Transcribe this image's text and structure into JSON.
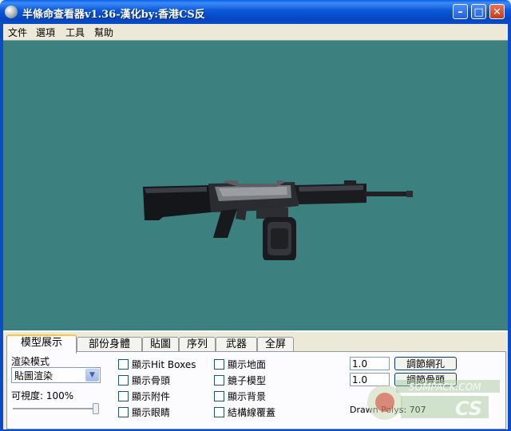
{
  "window": {
    "title": "半條命查看器v1.36-漢化by:香港CS反",
    "minimize_label": "–",
    "maximize_label": "□",
    "close_label": "✕"
  },
  "menu": [
    "文件",
    "選項",
    "工具",
    "幫助"
  ],
  "tabs": [
    "模型展示",
    "部份身體",
    "貼圖",
    "序列",
    "武器",
    "全屏"
  ],
  "render": {
    "section_label": "渲染模式",
    "mode_value": "貼圖渲染",
    "opacity_label": "可視度: 100%",
    "opacity_percent": 100
  },
  "checkboxes_col1": [
    "顯示Hit Boxes",
    "顯示骨頭",
    "顯示附件",
    "顯示眼睛"
  ],
  "checkboxes_col2": [
    "顯示地面",
    "鏡子模型",
    "顯示背景",
    "結構線覆蓋"
  ],
  "adjust": {
    "mesh_value": "1.0",
    "mesh_button": "調節網孔",
    "bone_value": "1.0",
    "bone_button": "調節骨頭",
    "polys": "Drawn Polys: 707"
  },
  "watermark": {
    "site": "5OMPACK.COM",
    "brand": "CS"
  },
  "colors": {
    "viewport_bg": "#3C807F",
    "titlebar": "#0A57D8",
    "panel": "#ECE9D8"
  }
}
